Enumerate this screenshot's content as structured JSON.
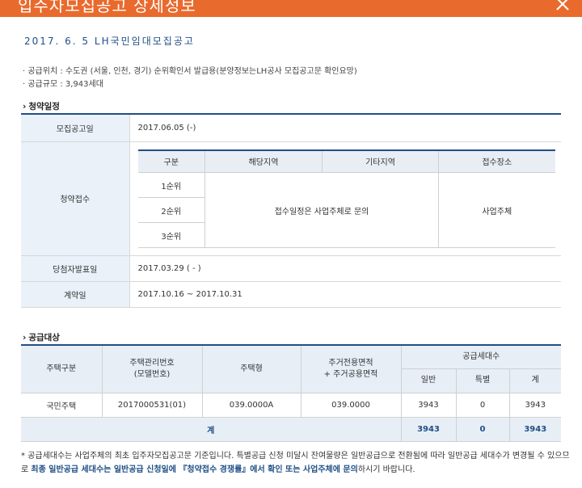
{
  "window": {
    "title": "입주자모집공고 상세정보",
    "accent": "#e96a2d"
  },
  "notice": {
    "title": "2017. 6. 5 LH국민임대모집공고",
    "location_line": "· 공급위치 : 수도권 (서울, 인천, 경기)  순위확인서 발급용(분양정보는LH공사 모집공고문 확인요망)",
    "scale_line": "· 공급규모 : 3,943세대"
  },
  "schedule": {
    "section_title": "청약일정",
    "rows": {
      "announce": {
        "label": "모집공고일",
        "value": "2017.06.05 (-)"
      },
      "apply": {
        "label": "청약접수"
      },
      "winner": {
        "label": "당첨자발표일",
        "value": "2017.03.29 ( - )"
      },
      "contract": {
        "label": "계약일",
        "value": "2017.10.16 ~ 2017.10.31"
      }
    },
    "apply_table": {
      "headers": [
        "구분",
        "해당지역",
        "기타지역",
        "접수장소"
      ],
      "ranks": [
        "1순위",
        "2순위",
        "3순위"
      ],
      "schedule_text": "접수일정은 사업주체로 문의",
      "place": "사업주체"
    }
  },
  "supply": {
    "section_title": "공급대상",
    "headers": {
      "type": "주택구분",
      "mgmt_no": "주택관리번호\n(모델번호)",
      "housing_type": "주택형",
      "area": "주거전용면적\n+ 주거공용면적",
      "units": "공급세대수",
      "general": "일반",
      "special": "특별",
      "sum": "계"
    },
    "rows": [
      {
        "type": "국민주택",
        "mgmt_no": "2017000531(01)",
        "housing_type": "039.0000A",
        "area": "039.0000",
        "general": "3943",
        "special": "0",
        "sum": "3943"
      }
    ],
    "total": {
      "label": "계",
      "general": "3943",
      "special": "0",
      "sum": "3943"
    }
  },
  "footnote": {
    "part1": "* 공급세대수는 사업주체의 최초 입주자모집공고문 기준입니다. 특별공급 신청 미달시 잔여물량은 일반공급으로 전환됨에 따라 일반공급 세대수가 변경될 수 있으므로 ",
    "highlight": "최종 일반공급 세대수는 일반공급 신청일에 『청약접수 경쟁률』에서 확인 또는 사업주체에 문의",
    "part2": "하시기 바랍니다."
  }
}
